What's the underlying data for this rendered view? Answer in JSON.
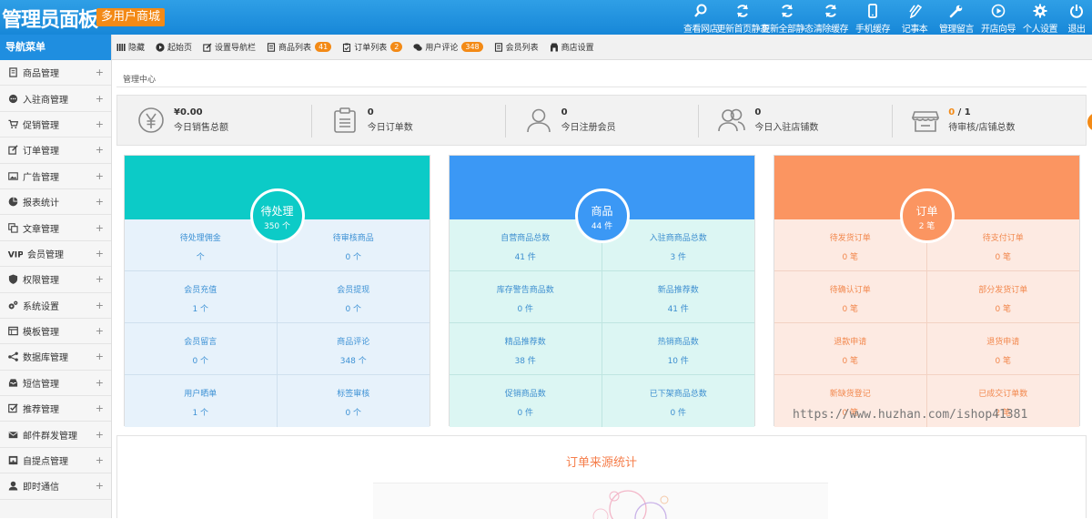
{
  "header": {
    "title": "管理员面板",
    "badge": "多用户商城",
    "nav": [
      {
        "label": "查看网店",
        "icon": "search-icon"
      },
      {
        "label": "更新首页静态",
        "icon": "refresh-icon"
      },
      {
        "label": "更新全部静态",
        "icon": "refresh-icon"
      },
      {
        "label": "清除缓存",
        "icon": "refresh-icon"
      },
      {
        "label": "手机缓存",
        "icon": "phone-icon"
      },
      {
        "label": "记事本",
        "icon": "pen-icon"
      },
      {
        "label": "管理留言",
        "icon": "wrench-icon"
      },
      {
        "label": "开店向导",
        "icon": "play-icon"
      },
      {
        "label": "个人设置",
        "icon": "gear-icon"
      },
      {
        "label": "退出",
        "icon": "power-icon"
      }
    ]
  },
  "sidebar": {
    "heading": "导航菜单",
    "items": [
      {
        "label": "商品管理",
        "icon": "product-icon"
      },
      {
        "label": "入驻商管理",
        "icon": "chat-icon"
      },
      {
        "label": "促销管理",
        "icon": "cart-icon"
      },
      {
        "label": "订单管理",
        "icon": "edit-icon"
      },
      {
        "label": "广告管理",
        "icon": "image-icon"
      },
      {
        "label": "报表统计",
        "icon": "pie-icon"
      },
      {
        "label": "文章管理",
        "icon": "copy-icon"
      },
      {
        "label": "会员管理",
        "icon": "vip-icon"
      },
      {
        "label": "权限管理",
        "icon": "shield-icon"
      },
      {
        "label": "系统设置",
        "icon": "gears-icon"
      },
      {
        "label": "模板管理",
        "icon": "template-icon"
      },
      {
        "label": "数据库管理",
        "icon": "share-icon"
      },
      {
        "label": "短信管理",
        "icon": "inbox-icon"
      },
      {
        "label": "推荐管理",
        "icon": "check-icon"
      },
      {
        "label": "邮件群发管理",
        "icon": "mail-icon"
      },
      {
        "label": "自提点管理",
        "icon": "storefront-icon"
      },
      {
        "label": "即时通信",
        "icon": "user-icon"
      }
    ],
    "expand_symbol": "+"
  },
  "tabs": [
    {
      "label": "隐藏",
      "icon": "columns-icon"
    },
    {
      "label": "起始页",
      "icon": "play-circle-icon"
    },
    {
      "label": "设置导航栏",
      "icon": "edit-icon"
    },
    {
      "label": "商品列表",
      "icon": "product-icon",
      "badge": "41"
    },
    {
      "label": "订单列表",
      "icon": "clipboard-icon",
      "badge": "2"
    },
    {
      "label": "用户评论",
      "icon": "comments-icon",
      "badge": "348"
    },
    {
      "label": "会员列表",
      "icon": "list-icon"
    },
    {
      "label": "商店设置",
      "icon": "settings-icon"
    }
  ],
  "breadcrumb": "管理中心",
  "stats": [
    {
      "value": "¥0.00",
      "label": "今日销售总额",
      "icon": "yen-icon"
    },
    {
      "value": "0",
      "label": "今日订单数",
      "icon": "clipboard-icon"
    },
    {
      "value": "0",
      "label": "今日注册会员",
      "icon": "user-icon"
    },
    {
      "value": "0",
      "label": "今日入驻店铺数",
      "icon": "users-icon"
    },
    {
      "value_a": "0",
      "value_sep": " / ",
      "value_b": "1",
      "label": "待审核/店铺总数",
      "icon": "store-icon"
    }
  ],
  "panels": [
    {
      "title": "待处理",
      "value": "350 个",
      "color": "#0ccbc7",
      "cells": [
        {
          "label": "待处理佣金",
          "value": "个"
        },
        {
          "label": "待审核商品",
          "value": "0 个"
        },
        {
          "label": "会员充值",
          "value": "1 个"
        },
        {
          "label": "会员提现",
          "value": "0 个"
        },
        {
          "label": "会员留言",
          "value": "0 个"
        },
        {
          "label": "商品评论",
          "value": "348 个"
        },
        {
          "label": "用户晒单",
          "value": "1 个"
        },
        {
          "label": "标签审核",
          "value": "0 个"
        }
      ]
    },
    {
      "title": "商品",
      "value": "44 件",
      "color": "#3b98f5",
      "cells": [
        {
          "label": "自营商品总数",
          "value": "41 件"
        },
        {
          "label": "入驻商商品总数",
          "value": "3 件"
        },
        {
          "label": "库存警告商品数",
          "value": "0 件"
        },
        {
          "label": "新品推荐数",
          "value": "41 件"
        },
        {
          "label": "精品推荐数",
          "value": "38 件"
        },
        {
          "label": "热销商品数",
          "value": "10 件"
        },
        {
          "label": "促销商品数",
          "value": "0 件"
        },
        {
          "label": "已下架商品总数",
          "value": "0 件"
        }
      ]
    },
    {
      "title": "订单",
      "value": "2 笔",
      "color": "#fb9561",
      "cells": [
        {
          "label": "待发货订单",
          "value": "0 笔"
        },
        {
          "label": "待支付订单",
          "value": "0 笔"
        },
        {
          "label": "待确认订单",
          "value": "0 笔"
        },
        {
          "label": "部分发货订单",
          "value": "0 笔"
        },
        {
          "label": "退款申请",
          "value": "0 笔"
        },
        {
          "label": "退货申请",
          "value": "0 笔"
        },
        {
          "label": "新缺货登记",
          "value": "0 笔"
        },
        {
          "label": "已成交订单数",
          "value": "2 笔"
        }
      ]
    }
  ],
  "order_source": {
    "title": "订单来源统计"
  },
  "watermark": "https://www.huzhan.com/ishop41381"
}
